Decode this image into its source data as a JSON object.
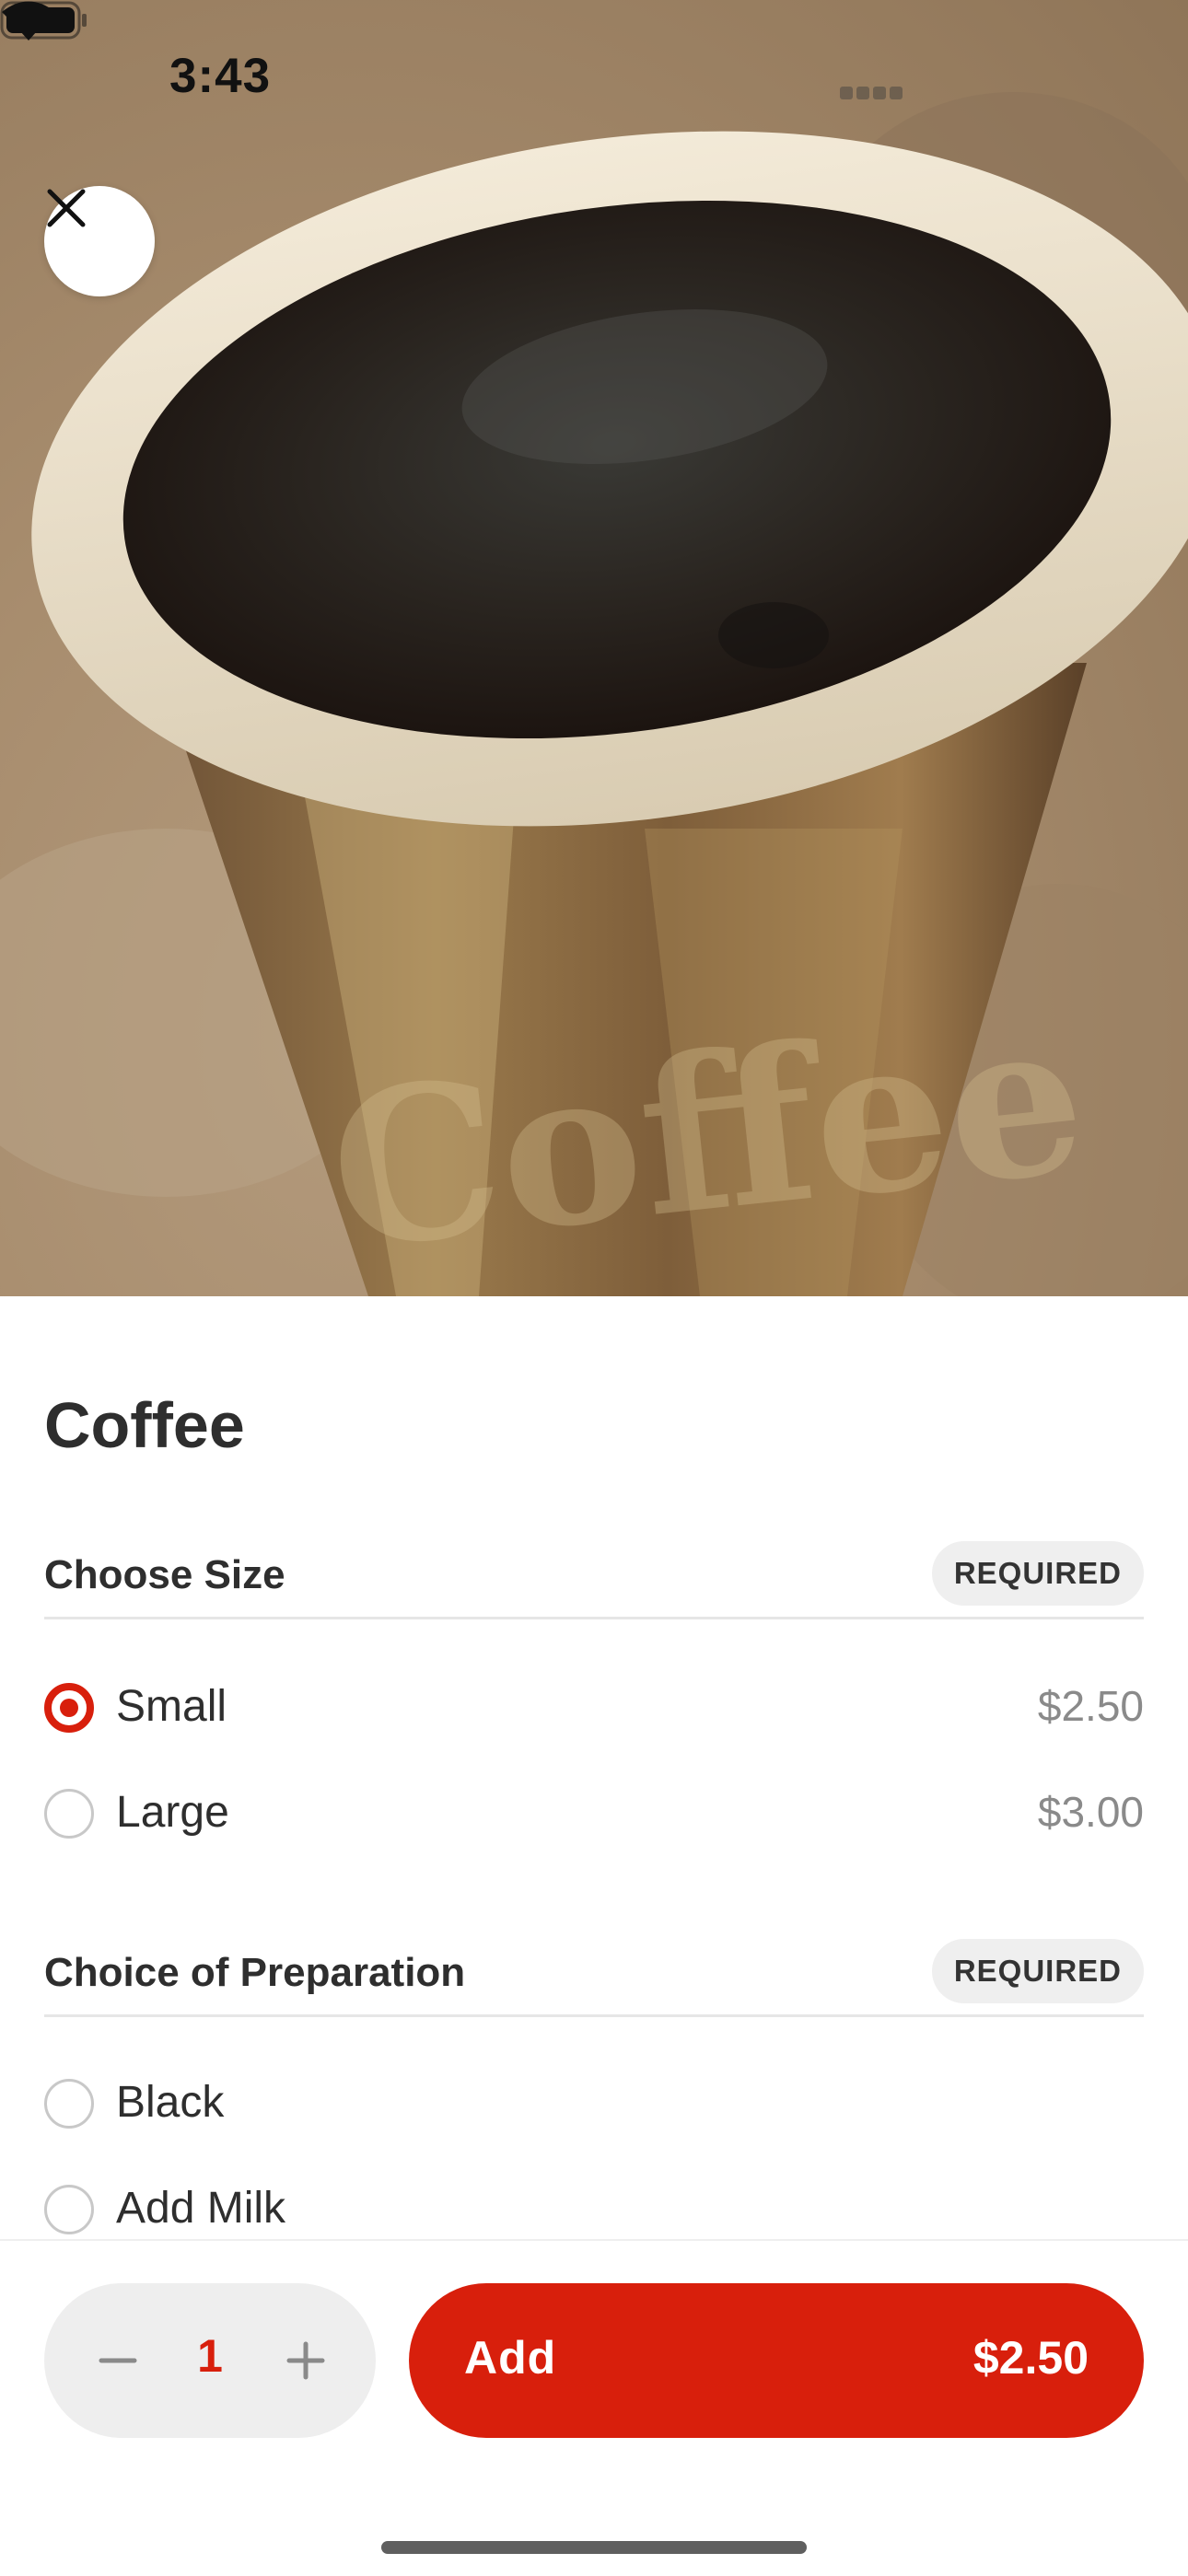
{
  "status_bar": {
    "time": "3:43"
  },
  "hero": {
    "image_subject": "coffee-cup-photo",
    "close_icon": "close-icon"
  },
  "item": {
    "title": "Coffee"
  },
  "sections": [
    {
      "title": "Choose Size",
      "badge": "REQUIRED",
      "options": [
        {
          "label": "Small",
          "price": "$2.50",
          "selected": true
        },
        {
          "label": "Large",
          "price": "$3.00",
          "selected": false
        }
      ]
    },
    {
      "title": "Choice of Preparation",
      "badge": "REQUIRED",
      "options": [
        {
          "label": "Black",
          "price": "",
          "selected": false
        },
        {
          "label": "Add Milk",
          "price": "",
          "selected": false
        }
      ]
    }
  ],
  "footer": {
    "quantity": "1",
    "add_label": "Add",
    "add_price": "$2.50"
  },
  "colors": {
    "accent": "#d81f0c",
    "badge_bg": "#efefef",
    "stepper_bg": "#eeeeee"
  }
}
